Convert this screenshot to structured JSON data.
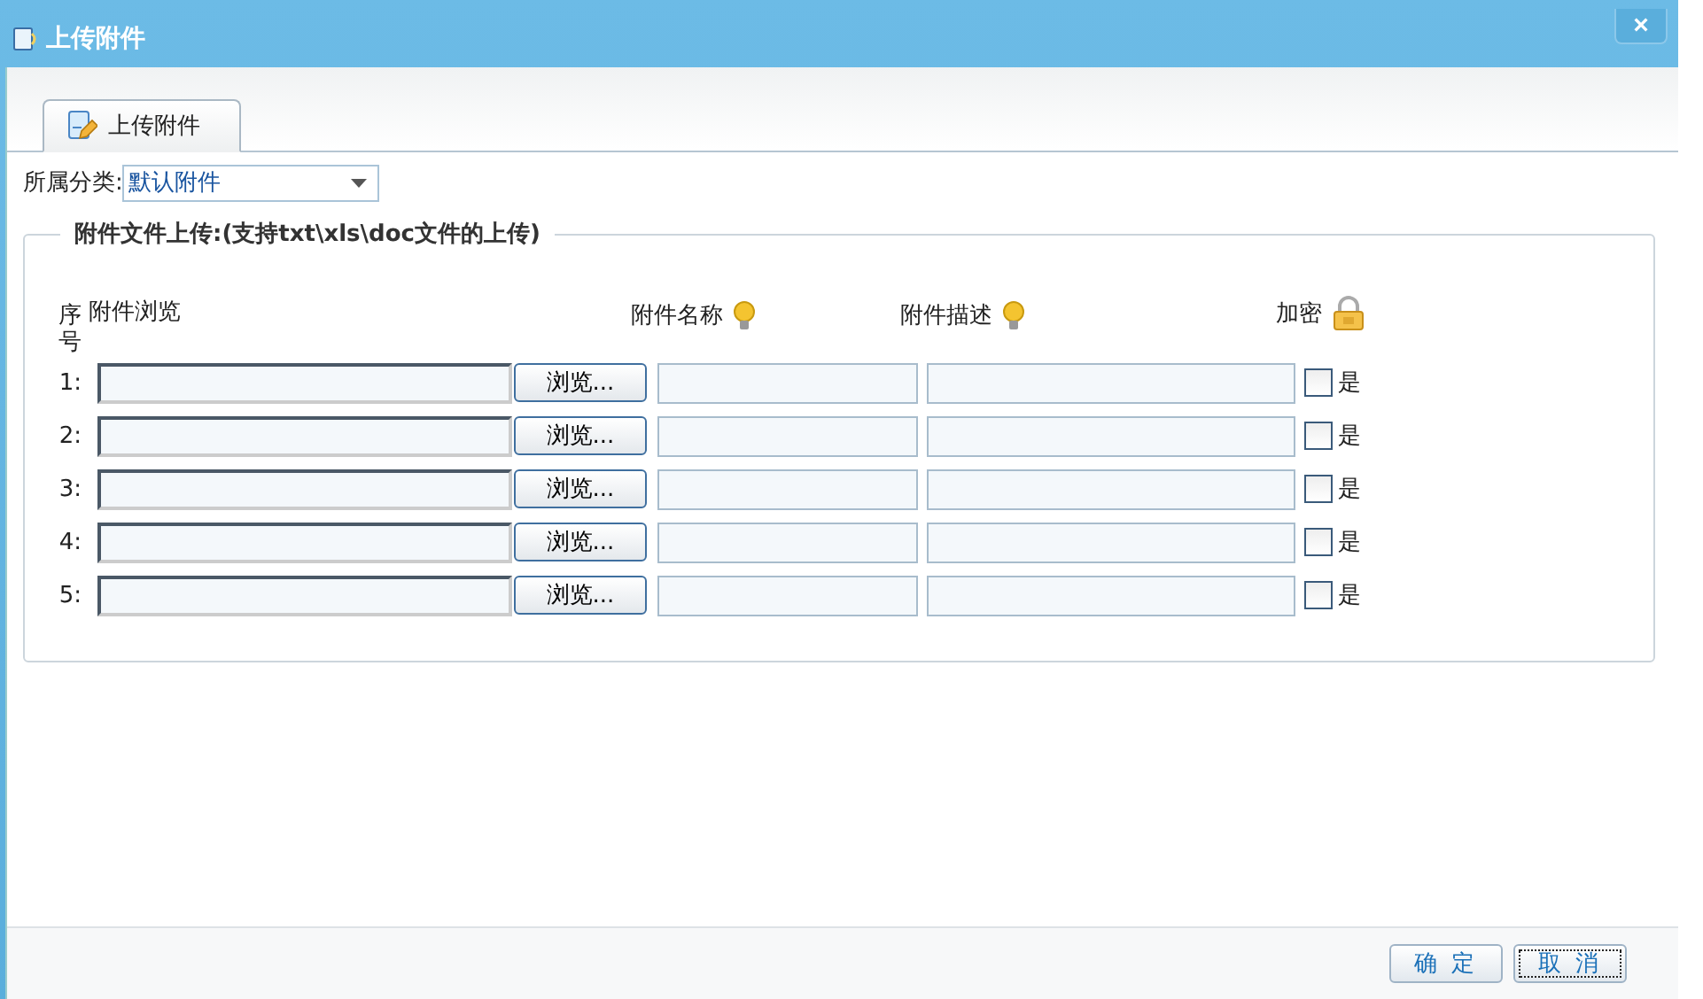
{
  "window": {
    "title": "上传附件",
    "close": "×"
  },
  "tabs": [
    {
      "label": "上传附件",
      "selected": true
    }
  ],
  "category": {
    "label": "所属分类:",
    "value": "默认附件"
  },
  "fieldset": {
    "legend": "附件文件上传:(支持txt\\xls\\doc文件的上传)",
    "columns": {
      "index": "序号",
      "file": "附件浏览",
      "name": "附件名称",
      "description": "附件描述",
      "encrypt": "加密"
    },
    "rows": [
      {
        "index": "1:",
        "browse": "浏览...",
        "checked": false,
        "encrypt_label": "是"
      },
      {
        "index": "2:",
        "browse": "浏览...",
        "checked": false,
        "encrypt_label": "是"
      },
      {
        "index": "3:",
        "browse": "浏览...",
        "checked": false,
        "encrypt_label": "是"
      },
      {
        "index": "4:",
        "browse": "浏览...",
        "checked": false,
        "encrypt_label": "是"
      },
      {
        "index": "5:",
        "browse": "浏览...",
        "checked": false,
        "encrypt_label": "是"
      }
    ]
  },
  "buttons": [
    {
      "label": "确 定",
      "focused": false
    },
    {
      "label": "取 消",
      "focused": true
    }
  ]
}
